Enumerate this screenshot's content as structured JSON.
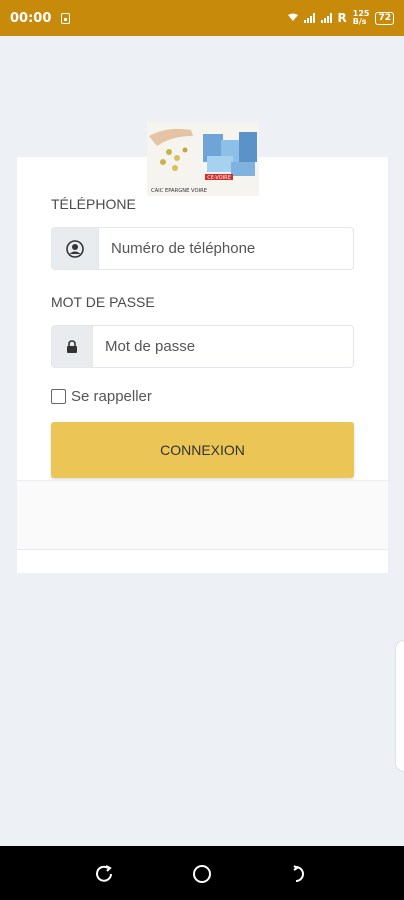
{
  "status_bar": {
    "time": "00:00",
    "carrier_indicator": "R",
    "net_speed": "125",
    "net_speed_unit": "B/s",
    "battery": "72"
  },
  "logo": {
    "text": "CAIC EPARGNE VOIRE",
    "badge": "CE-VOIRE"
  },
  "form": {
    "phone_label": "TÉLÉPHONE",
    "phone_placeholder": "Numéro de téléphone",
    "password_label": "MOT DE PASSE",
    "password_placeholder": "Mot de passe",
    "remember_label": "Se rappeller",
    "submit_label": "CONNEXION"
  },
  "colors": {
    "status_bar": "#c88a0a",
    "button": "#ebc556",
    "background": "#edf0f5"
  },
  "icons": {
    "phone_addon": "user-circle-icon",
    "password_addon": "lock-icon",
    "nav_back": "back-icon",
    "nav_home": "home-icon",
    "nav_recent": "recent-apps-icon"
  }
}
